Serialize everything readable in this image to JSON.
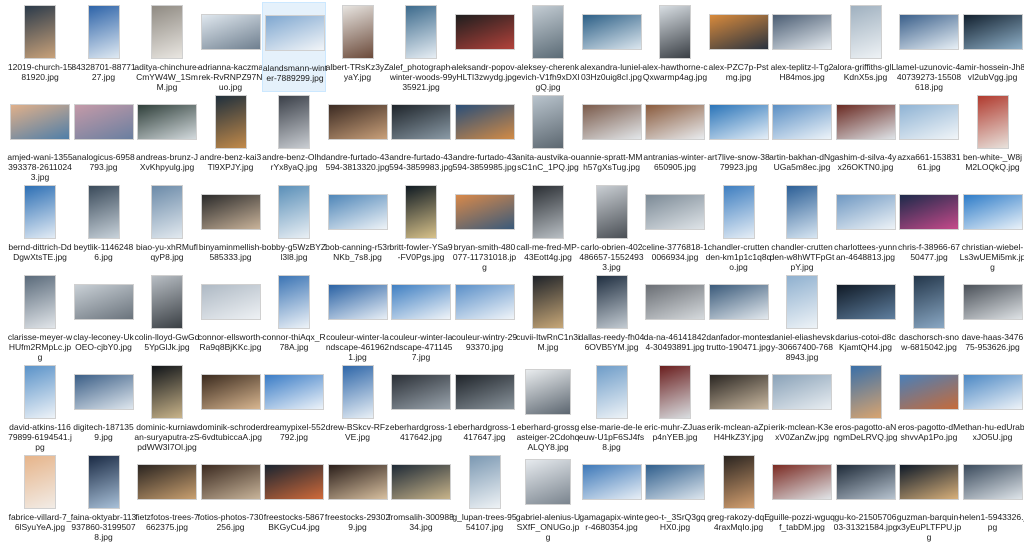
{
  "files": [
    {
      "name": "12019-church-1581920.jpg",
      "shape": "portrait",
      "c1": "#2b3a4a",
      "c2": "#c9a27a",
      "selected": false
    },
    {
      "name": "84328701-8877127.jpg",
      "shape": "portrait",
      "c1": "#2d63a8",
      "c2": "#dfe9f2",
      "selected": false
    },
    {
      "name": "aditya-chinchure-CmYW4W_1SmM.jpg",
      "shape": "portrait",
      "c1": "#8f8a82",
      "c2": "#e9e6e1",
      "selected": false
    },
    {
      "name": "adrianna-kaczmarek-RvRNPZ97Nuo.jpg",
      "shape": "landscape",
      "c1": "#dfe7ee",
      "c2": "#6f7f8f",
      "selected": false
    },
    {
      "name": "alandsmann-winter-7889299.jpg",
      "shape": "landscape",
      "c1": "#7fa7d0",
      "c2": "#f2f5f8",
      "selected": true
    },
    {
      "name": "albert-TRsKz3yZyaY.jpg",
      "shape": "portrait",
      "c1": "#e7e4e0",
      "c2": "#6b4a3a",
      "selected": false
    },
    {
      "name": "alef_photograph-winter-woods-9935921.jpg",
      "shape": "portrait",
      "c1": "#3c6a8c",
      "c2": "#e7eef4",
      "selected": false
    },
    {
      "name": "aleksandr-popov-yHLTI3zwydg.jpg",
      "shape": "landscape",
      "c1": "#1e1e1e",
      "c2": "#b3423b",
      "selected": false
    },
    {
      "name": "aleksey-cherenkevich-V1fh9xDXlgQ.jpg",
      "shape": "portrait",
      "c1": "#c3ccd3",
      "c2": "#5b6b76",
      "selected": false
    },
    {
      "name": "alexandra-luniel-03Hz0uig8cI.jpg",
      "shape": "landscape",
      "c1": "#2c5f86",
      "c2": "#dbe6ee",
      "selected": false
    },
    {
      "name": "alex-hawthorne-cQxwarmp4ag.jpg",
      "shape": "portrait",
      "c1": "#d7dde2",
      "c2": "#3a3f45",
      "selected": false
    },
    {
      "name": "alex-PZC7p-Pstmg.jpg",
      "shape": "landscape",
      "c1": "#d88a3c",
      "c2": "#2a3340",
      "selected": false
    },
    {
      "name": "alex-teplitz-l-Tg2H84mos.jpg",
      "shape": "landscape",
      "c1": "#4b5d73",
      "c2": "#e6ecf1",
      "selected": false
    },
    {
      "name": "alora-griffiths-glLlKdnX5s.jpg",
      "shape": "portrait",
      "c1": "#9fb0bf",
      "c2": "#eef2f5",
      "selected": false
    },
    {
      "name": "amel-uzunovic-440739273-15508618.jpg",
      "shape": "landscape",
      "c1": "#3a5f8a",
      "c2": "#e8f0f6",
      "selected": false
    },
    {
      "name": "amir-hossein-Jh8vI2ubVgg.jpg",
      "shape": "landscape",
      "c1": "#12202e",
      "c2": "#8fb0c8",
      "selected": false
    },
    {
      "name": "amjed-wani-1355393378-26110243.jpg",
      "shape": "landscape",
      "c1": "#e0b08a",
      "c2": "#4f7ea8",
      "selected": false
    },
    {
      "name": "analogicus-6958793.jpg",
      "shape": "landscape",
      "c1": "#c49aa8",
      "c2": "#6a7fa0",
      "selected": false
    },
    {
      "name": "andreas-brunz-JXvKhpyulg.jpg",
      "shape": "landscape",
      "c1": "#2f3f3a",
      "c2": "#d3dadd",
      "selected": false
    },
    {
      "name": "andre-benz-kai3Tl9XPJY.jpg",
      "shape": "portrait",
      "c1": "#1f2f3c",
      "c2": "#c28a4a",
      "selected": false
    },
    {
      "name": "andre-benz-OlhdrYx8yaQ.jpg",
      "shape": "portrait",
      "c1": "#3a3f48",
      "c2": "#c9cdd2",
      "selected": false
    },
    {
      "name": "andre-furtado-43594-3813320.jpg",
      "shape": "landscape",
      "c1": "#3b2a22",
      "c2": "#c9a07a",
      "selected": false
    },
    {
      "name": "andre-furtado-43594-3859983.jpg",
      "shape": "landscape",
      "c1": "#1e242a",
      "c2": "#8a9aa6",
      "selected": false
    },
    {
      "name": "andre-furtado-43594-3859985.jpg",
      "shape": "landscape",
      "c1": "#2a4e78",
      "c2": "#d28b46",
      "selected": false
    },
    {
      "name": "anita-austvika-ousC1nC_1PQ.jpg",
      "shape": "portrait",
      "c1": "#b9c4cd",
      "c2": "#5c6770",
      "selected": false
    },
    {
      "name": "annie-spratt-MMh57gXsTug.jpg",
      "shape": "landscape",
      "c1": "#7a5a4a",
      "c2": "#e3e7ea",
      "selected": false
    },
    {
      "name": "antranias-winter-650905.jpg",
      "shape": "landscape",
      "c1": "#8a5b3d",
      "c2": "#e9ecef",
      "selected": false
    },
    {
      "name": "art7live-snow-3879923.jpg",
      "shape": "landscape",
      "c1": "#2a74b8",
      "c2": "#e4eef7",
      "selected": false
    },
    {
      "name": "artin-bakhan-dNgUGa5m8ec.jpg",
      "shape": "landscape",
      "c1": "#5b8fc4",
      "c2": "#eef4f9",
      "selected": false
    },
    {
      "name": "ashim-d-silva-4yx26OKTN0.jpg",
      "shape": "landscape",
      "c1": "#6a2a22",
      "c2": "#dfe4e8",
      "selected": false
    },
    {
      "name": "azxa661-15383161.jpg",
      "shape": "landscape",
      "c1": "#8fb3d4",
      "c2": "#f1f5f8",
      "selected": false
    },
    {
      "name": "ben-white-_W8jM2LOQkQ.jpg",
      "shape": "portrait",
      "c1": "#b03a2e",
      "c2": "#e8e2dc",
      "selected": false
    },
    {
      "name": "bernd-dittrich-DdDgwXtsTE.jpg",
      "shape": "portrait",
      "c1": "#2d6fb4",
      "c2": "#e3ecf5",
      "selected": false
    },
    {
      "name": "beytlik-11462486.jpg",
      "shape": "portrait",
      "c1": "#3a4a5a",
      "c2": "#c8d2da",
      "selected": false
    },
    {
      "name": "biao-yu-xhRMuflqyP8.jpg",
      "shape": "portrait",
      "c1": "#6b8aa8",
      "c2": "#e2e9ef",
      "selected": false
    },
    {
      "name": "binyaminmellish-585333.jpg",
      "shape": "landscape",
      "c1": "#2a2a2a",
      "c2": "#c9b39a",
      "selected": false
    },
    {
      "name": "bobby-g5WzBYZl3l8.jpg",
      "shape": "portrait",
      "c1": "#5a8fb8",
      "c2": "#e9eff4",
      "selected": false
    },
    {
      "name": "bob-canning-r53rNKb_7s8.jpg",
      "shape": "landscape",
      "c1": "#4f86b8",
      "c2": "#eef3f7",
      "selected": false
    },
    {
      "name": "britt-fowler-YSa9-FV0Pgs.jpg",
      "shape": "portrait",
      "c1": "#0f1a22",
      "c2": "#d8c28a",
      "selected": false
    },
    {
      "name": "bryan-smith-480077-11731018.jpg",
      "shape": "landscape",
      "c1": "#d8894a",
      "c2": "#3a5a7a",
      "selected": false
    },
    {
      "name": "call-me-fred-MP-43Eott4g.jpg",
      "shape": "portrait",
      "c1": "#2a2e33",
      "c2": "#b9bfc4",
      "selected": false
    },
    {
      "name": "carlo-obrien-402486657-15524933.jpg",
      "shape": "portrait",
      "c1": "#c9ced3",
      "c2": "#4a4f55",
      "selected": false
    },
    {
      "name": "celine-3776818-10066934.jpg",
      "shape": "landscape",
      "c1": "#7c8a96",
      "c2": "#dfe4e8",
      "selected": false
    },
    {
      "name": "chandler-cruttenden-km1p1c1q8qo.jpg",
      "shape": "portrait",
      "c1": "#3e7ec0",
      "c2": "#e6eef6",
      "selected": false
    },
    {
      "name": "chandler-cruttenden-w8hWTFpGtpY.jpg",
      "shape": "portrait",
      "c1": "#2c5f96",
      "c2": "#d8e6f2",
      "selected": false
    },
    {
      "name": "charlottees-yunnan-4648813.jpg",
      "shape": "landscape",
      "c1": "#6f98c2",
      "c2": "#eef3f7",
      "selected": false
    },
    {
      "name": "chris-f-38966-6750477.jpg",
      "shape": "landscape",
      "c1": "#1c2a4a",
      "c2": "#c64a8a",
      "selected": false
    },
    {
      "name": "christian-wiebel-Ls3wUEMi5mk.jpg",
      "shape": "landscape",
      "c1": "#2e7cc8",
      "c2": "#eaf2f9",
      "selected": false
    },
    {
      "name": "clarisse-meyer-wHUfm2RMpLc.jpg",
      "shape": "portrait",
      "c1": "#5a6a7a",
      "c2": "#e2e6ea",
      "selected": false
    },
    {
      "name": "clay-leconey-UkOEO-cjbY0.jpg",
      "shape": "landscape",
      "c1": "#c9d0d6",
      "c2": "#6a737c",
      "selected": false
    },
    {
      "name": "colin-lloyd-GwGd5YpGlJk.jpg",
      "shape": "portrait",
      "c1": "#b8bec4",
      "c2": "#3a3f44",
      "selected": false
    },
    {
      "name": "connor-ellsworth-Ra9q8BjKKc.jpg",
      "shape": "landscape",
      "c1": "#aeb9c4",
      "c2": "#eef1f4",
      "selected": false
    },
    {
      "name": "connor-thiAqx_R78A.jpg",
      "shape": "portrait",
      "c1": "#3b74b4",
      "c2": "#eef3f8",
      "selected": false
    },
    {
      "name": "couleur-winter-landscape-4619621.jpg",
      "shape": "landscape",
      "c1": "#2a62a4",
      "c2": "#e8eff6",
      "selected": false
    },
    {
      "name": "couleur-winter-landscape-4711457.jpg",
      "shape": "landscape",
      "c1": "#3f7fc2",
      "c2": "#f0f4f8",
      "selected": false
    },
    {
      "name": "couleur-wintry-2993370.jpg",
      "shape": "landscape",
      "c1": "#5a8fc8",
      "c2": "#f1f5f9",
      "selected": false
    },
    {
      "name": "cuvii-ItwRnC1n3iM.jpg",
      "shape": "portrait",
      "c1": "#1e2228",
      "c2": "#c8a878",
      "selected": false
    },
    {
      "name": "dallas-reedy-fh046OVB5YM.jpg",
      "shape": "portrait",
      "c1": "#1f2e40",
      "c2": "#c3cbd2",
      "selected": false
    },
    {
      "name": "da-na-461418424-30493891.jpg",
      "shape": "landscape",
      "c1": "#6a6e74",
      "c2": "#d6dadd",
      "selected": false
    },
    {
      "name": "danfador-montestrutto-190471.jpg",
      "shape": "landscape",
      "c1": "#3a5a7a",
      "c2": "#e3e9ee",
      "selected": false
    },
    {
      "name": "daniel-eliashevsky-30667400-7688943.jpg",
      "shape": "portrait",
      "c1": "#8fb0cf",
      "c2": "#eef3f7",
      "selected": false
    },
    {
      "name": "darius-cotoi-d8cKjamtQH4.jpg",
      "shape": "landscape",
      "c1": "#101a26",
      "c2": "#5f7f9f",
      "selected": false
    },
    {
      "name": "daschorsch-snow-6815042.jpg",
      "shape": "portrait",
      "c1": "#23364a",
      "c2": "#8aa8c4",
      "selected": false
    },
    {
      "name": "dave-haas-347675-953626.jpg",
      "shape": "landscape",
      "c1": "#4a5058",
      "c2": "#dfe3e6",
      "selected": false
    },
    {
      "name": "david-atkins-11679899-6194541.jpg",
      "shape": "portrait",
      "c1": "#5a92c8",
      "c2": "#eef3f8",
      "selected": false
    },
    {
      "name": "digitech-1871359.jpg",
      "shape": "landscape",
      "c1": "#3b5e86",
      "c2": "#dfe7ee",
      "selected": false
    },
    {
      "name": "dominic-kurniawan-suryaputra-zSpdWW3I7Ol.jpg",
      "shape": "portrait",
      "c1": "#101418",
      "c2": "#c9b48a",
      "selected": false
    },
    {
      "name": "dominik-schroder-6vdtubiccaA.jpg",
      "shape": "landscape",
      "c1": "#3a2a1e",
      "c2": "#d8b690",
      "selected": false
    },
    {
      "name": "dreamypixel-552792.jpg",
      "shape": "landscape",
      "c1": "#3a7cc6",
      "c2": "#edf3f9",
      "selected": false
    },
    {
      "name": "drew-BSkcv-RFzVE.jpg",
      "shape": "portrait",
      "c1": "#2e66a8",
      "c2": "#e9f0f6",
      "selected": false
    },
    {
      "name": "eberhardgross-1417642.jpg",
      "shape": "landscape",
      "c1": "#2a2f36",
      "c2": "#9aa4ad",
      "selected": false
    },
    {
      "name": "eberhardgross-1417647.jpg",
      "shape": "landscape",
      "c1": "#1f242a",
      "c2": "#8a949c",
      "selected": false
    },
    {
      "name": "eberhard-grossgasteiger-2CdohqALQY8.jpg",
      "shape": "square",
      "c1": "#e9ecee",
      "c2": "#5c6670",
      "selected": false
    },
    {
      "name": "else-marie-de-leeuw-U1pF6SJ4fs8.jpg",
      "shape": "portrait",
      "c1": "#6e9cc8",
      "c2": "#eef3f7",
      "selected": false
    },
    {
      "name": "eric-muhr-ZJuasp4nYEB.jpg",
      "shape": "portrait",
      "c1": "#6a1e1e",
      "c2": "#d9dde0",
      "selected": false
    },
    {
      "name": "erik-mclean-aZpiH4HkZ3Y.jpg",
      "shape": "landscape",
      "c1": "#2a2622",
      "c2": "#c9b8a0",
      "selected": false
    },
    {
      "name": "erik-mclean-K3exV0ZanZw.jpg",
      "shape": "landscape",
      "c1": "#8aa2b8",
      "c2": "#e8edf1",
      "selected": false
    },
    {
      "name": "eros-pagotto-aNngmDeLRVQ.jpg",
      "shape": "portrait",
      "c1": "#3a6fa8",
      "c2": "#d8a470",
      "selected": false
    },
    {
      "name": "eros-pagotto-dMshvvAp1Po.jpg",
      "shape": "landscape",
      "c1": "#4a7fb8",
      "c2": "#c66b3a",
      "selected": false
    },
    {
      "name": "ethan-hu-edUrabxJO5U.jpg",
      "shape": "landscape",
      "c1": "#4c88c4",
      "c2": "#eef3f8",
      "selected": false
    },
    {
      "name": "fabrice-villard-7_6lSyuYeA.jpg",
      "shape": "portrait",
      "c1": "#e6b48a",
      "c2": "#f2ece6",
      "selected": false
    },
    {
      "name": "faina-oktyabr-113937860-31995078.jpg",
      "shape": "portrait",
      "c1": "#1a2a44",
      "c2": "#a8c0d8",
      "selected": false
    },
    {
      "name": "fietzfotos-trees-7662375.jpg",
      "shape": "landscape",
      "c1": "#2a2420",
      "c2": "#c9a070",
      "selected": false
    },
    {
      "name": "fotios-photos-730256.jpg",
      "shape": "landscape",
      "c1": "#3b2a20",
      "c2": "#c8b49a",
      "selected": false
    },
    {
      "name": "freestocks-5867BKGyCu4.jpg",
      "shape": "landscape",
      "c1": "#1a2430",
      "c2": "#d06a3a",
      "selected": false
    },
    {
      "name": "freestocks-293029.jpg",
      "shape": "landscape",
      "c1": "#2a1e1a",
      "c2": "#d8c0a0",
      "selected": false
    },
    {
      "name": "fromsalih-30098834.jpg",
      "shape": "landscape",
      "c1": "#1e2a36",
      "c2": "#c8b48a",
      "selected": false
    },
    {
      "name": "g_lupan-trees-9554107.jpg",
      "shape": "portrait",
      "c1": "#7b98b2",
      "c2": "#eef2f5",
      "selected": false
    },
    {
      "name": "gabriel-alenius-USXfF_ONUGo.jpg",
      "shape": "square",
      "c1": "#e6eaee",
      "c2": "#7a848e",
      "selected": false
    },
    {
      "name": "gamagapix-winter-4680354.jpg",
      "shape": "landscape",
      "c1": "#3d78b8",
      "c2": "#e8eff6",
      "selected": false
    },
    {
      "name": "geo-t-_3SrQ3gqHX0.jpg",
      "shape": "landscape",
      "c1": "#2f5e8c",
      "c2": "#dde6ee",
      "selected": false
    },
    {
      "name": "greg-rakozy-dqE4raxMqIo.jpg",
      "shape": "portrait",
      "c1": "#2a2420",
      "c2": "#d4a070",
      "selected": false
    },
    {
      "name": "guille-pozzi-wguqf_tabDM.jpg",
      "shape": "landscape",
      "c1": "#7a2a22",
      "c2": "#e1e5e8",
      "selected": false
    },
    {
      "name": "gu-ko-2150570603-31321584.jpg",
      "shape": "landscape",
      "c1": "#1e2a38",
      "c2": "#b8c4d0",
      "selected": false
    },
    {
      "name": "guzman-barquin-x3yEuPLTFPU.jpg",
      "shape": "landscape",
      "c1": "#0e1a28",
      "c2": "#d8b07a",
      "selected": false
    },
    {
      "name": "helen1-5943326.jpg",
      "shape": "landscape",
      "c1": "#3a4a5c",
      "c2": "#dfe5ea",
      "selected": false
    }
  ]
}
